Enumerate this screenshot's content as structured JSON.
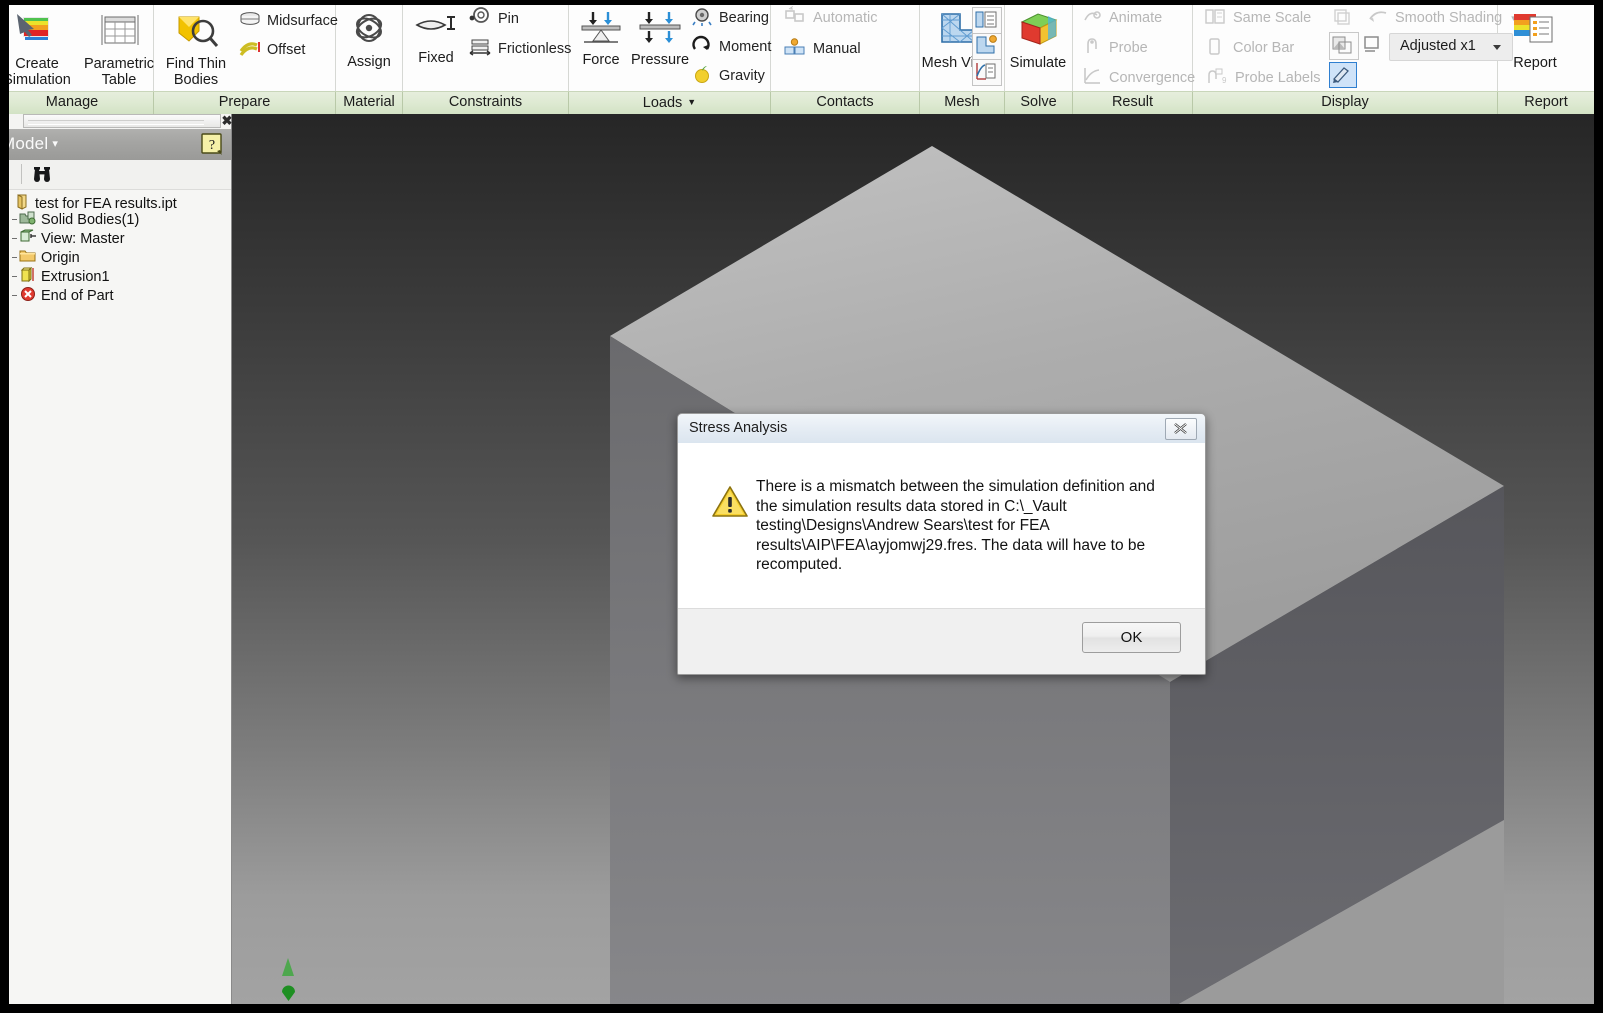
{
  "ribbon": {
    "groups": [
      {
        "name": "manage",
        "caption": "Manage",
        "items": [
          {
            "label": "Create\nSimulation",
            "icon": "create-simulation-icon"
          },
          {
            "label": "Parametric\nTable",
            "icon": "parametric-table-icon"
          }
        ]
      },
      {
        "name": "prepare",
        "caption": "Prepare",
        "items": [
          {
            "label": "Find Thin\nBodies",
            "icon": "find-thin-bodies-icon"
          },
          {
            "label": "Midsurface",
            "icon": "midsurface-icon"
          },
          {
            "label": "Offset",
            "icon": "offset-icon"
          }
        ]
      },
      {
        "name": "material",
        "caption": "Material",
        "items": [
          {
            "label": "Assign",
            "icon": "assign-material-icon"
          }
        ]
      },
      {
        "name": "constraints",
        "caption": "Constraints",
        "items": [
          {
            "label": "Fixed",
            "icon": "fixed-constraint-icon"
          },
          {
            "label": "Pin",
            "icon": "pin-constraint-icon"
          },
          {
            "label": "Frictionless",
            "icon": "frictionless-constraint-icon"
          }
        ]
      },
      {
        "name": "loads",
        "caption": "Loads",
        "caption_has_caret": true,
        "items": [
          {
            "label": "Force",
            "icon": "force-icon"
          },
          {
            "label": "Pressure",
            "icon": "pressure-icon"
          },
          {
            "label": "Bearing",
            "icon": "bearing-load-icon"
          },
          {
            "label": "Moment",
            "icon": "moment-icon"
          },
          {
            "label": "Gravity",
            "icon": "gravity-icon"
          }
        ]
      },
      {
        "name": "contacts",
        "caption": "Contacts",
        "items": [
          {
            "label": "Automatic",
            "icon": "automatic-contacts-icon",
            "disabled": true
          },
          {
            "label": "Manual",
            "icon": "manual-contact-icon"
          }
        ]
      },
      {
        "name": "mesh",
        "caption": "Mesh",
        "items": [
          {
            "label": "Mesh View",
            "icon": "mesh-view-icon"
          },
          {
            "label": "",
            "icon": "mesh-settings-icon"
          },
          {
            "label": "",
            "icon": "local-mesh-control-icon"
          },
          {
            "label": "",
            "icon": "convergence-settings-icon"
          }
        ]
      },
      {
        "name": "solve",
        "caption": "Solve",
        "items": [
          {
            "label": "Simulate",
            "icon": "simulate-icon"
          }
        ]
      },
      {
        "name": "result",
        "caption": "Result",
        "items": [
          {
            "label": "Animate",
            "icon": "animate-icon",
            "disabled": true
          },
          {
            "label": "Probe",
            "icon": "probe-icon",
            "disabled": true
          },
          {
            "label": "Convergence",
            "icon": "convergence-icon",
            "disabled": true
          }
        ]
      },
      {
        "name": "display",
        "caption": "Display",
        "items": [
          {
            "label": "Same Scale",
            "icon": "same-scale-icon",
            "disabled": true
          },
          {
            "label": "Color Bar",
            "icon": "color-bar-icon",
            "disabled": true
          },
          {
            "label": "Probe Labels",
            "icon": "probe-labels-icon",
            "disabled": true
          },
          {
            "label": "Smooth Shading",
            "icon": "smooth-shading-icon",
            "disabled": true
          },
          {
            "label": "Adjusted x1",
            "icon": "deformation-scale-dropdown"
          },
          {
            "label": "",
            "icon": "display-toggle-icon",
            "selected": true
          }
        ]
      },
      {
        "name": "report",
        "caption": "Report",
        "items": [
          {
            "label": "Report",
            "icon": "report-icon"
          }
        ]
      }
    ],
    "smooth_shading_caret": "▾"
  },
  "browser": {
    "title": "Model",
    "title_caret": "▾",
    "close_label": "✖",
    "help_icon": "help-question-icon",
    "find_icon": "find-binoculars-icon",
    "tree": [
      {
        "label": "test for FEA results.ipt",
        "icon": "part-document-icon",
        "level": 0
      },
      {
        "label": "Solid Bodies(1)",
        "icon": "solid-bodies-folder-icon",
        "level": 1
      },
      {
        "label": "View: Master",
        "icon": "view-master-icon",
        "level": 1
      },
      {
        "label": "Origin",
        "icon": "origin-folder-icon",
        "level": 1
      },
      {
        "label": "Extrusion1",
        "icon": "extrusion-feature-icon",
        "level": 1
      },
      {
        "label": "End of Part",
        "icon": "end-of-part-icon",
        "level": 1
      }
    ]
  },
  "viewport": {
    "axis_indicator": "origin-axis-marker",
    "model": "extruded-rectangular-block"
  },
  "dialog": {
    "title": "Stress Analysis",
    "close_label": "close-icon",
    "warning_icon": "warning-triangle-icon",
    "message": "There is a mismatch between the simulation definition and the simulation results data stored in C:\\_Vault testing\\Designs\\Andrew Sears\\test for FEA results\\AIP\\FEA\\ayjomwj29.fres. The data will have to be recomputed.",
    "ok_label": "OK"
  },
  "colors": {
    "ribbon_caption_green": "#dde9d1",
    "browser_header_gray": "#a4a4a2",
    "dialog_title_blue": "#e6edf4",
    "selected_button_blue": "#2f7fd0",
    "warning_yellow": "#f5c518",
    "axis_green": "#2e9e34"
  }
}
